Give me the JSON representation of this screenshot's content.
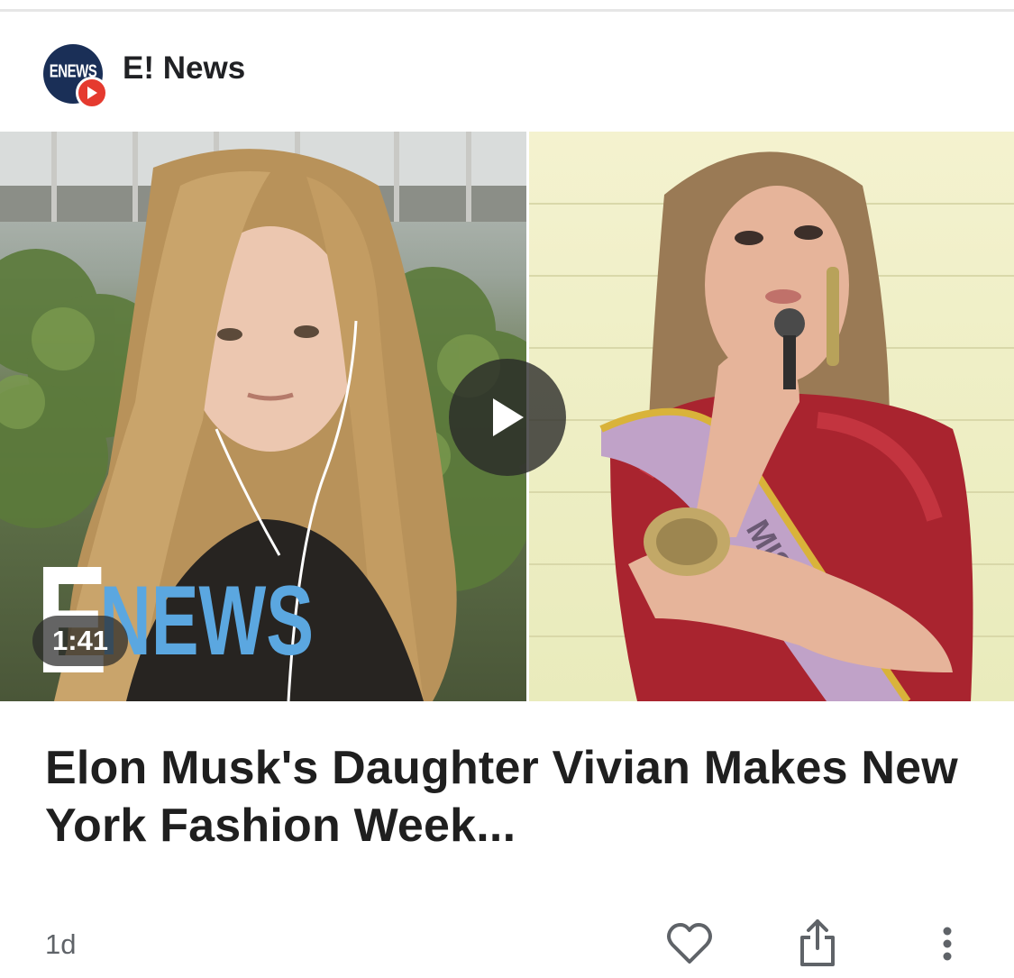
{
  "source": {
    "name": "E! News",
    "avatar_text": "ENEWS",
    "avatar_bg": "#1a2f57",
    "badge_color": "#e53a2f",
    "badge_icon": "play-icon"
  },
  "video": {
    "duration": "1:41",
    "play_icon": "play-icon",
    "watermark_letter": "E",
    "watermark_text": "NEWS",
    "watermark_color": "#5ba7e0",
    "sash_text": "MISS SC"
  },
  "article": {
    "headline": "Elon Musk's Daughter Vivian Makes New York Fashion Week..."
  },
  "footer": {
    "age": "1d",
    "actions": [
      "heart-icon",
      "share-icon",
      "more-vertical-icon"
    ]
  }
}
